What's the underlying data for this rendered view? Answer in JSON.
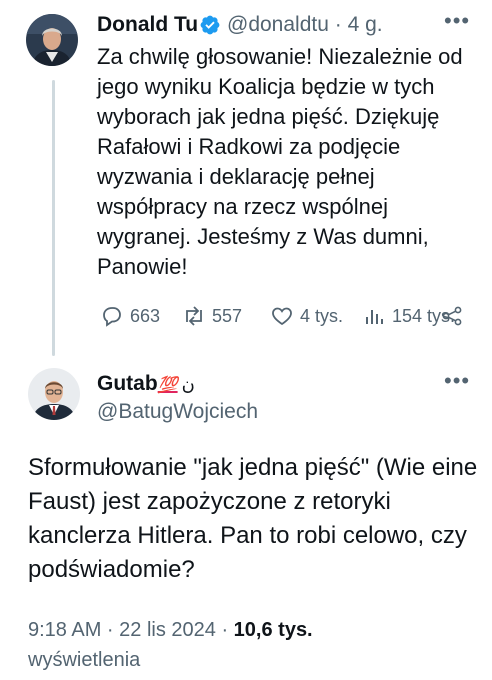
{
  "tweet": {
    "author_name": "Donald Tusk",
    "handle": "@donaldtu",
    "age": "4 g.",
    "more": "•••",
    "text": "Za chwilę głosowanie! Niezależnie od jego wyniku Koalicja będzie w tych wyborach jak jedna pięść. Dziękuję Rafałowi i Radkowi za podjęcie wyzwania i deklarację pełnej współpracy na rzecz wspólnej wygranej. Jesteśmy z Was dumni, Panowie!",
    "replies": "663",
    "reposts": "557",
    "likes": "4 tys.",
    "views": "154 tys.",
    "icons": [
      "reply-icon",
      "repost-icon",
      "like-icon",
      "views-icon",
      "share-icon"
    ],
    "colors": {
      "verified": "#1d9bf0",
      "secondary_text": "#536471"
    }
  },
  "reply": {
    "author_name": "Gutab",
    "name_emoji": "💯",
    "name_suffix": "ن",
    "handle": "@BatugWojciech",
    "more": "•••",
    "text": "Sformułowanie \"jak jedna pięść\" (Wie eine Faust) jest zapożyczone z retoryki kanclerza Hitlera. Pan to robi celowo, czy podświadomie?",
    "time": "9:18 AM · 22 lis 2024 · ",
    "views_count": "10,6 tys.",
    "views_label": "wyświetlenia"
  }
}
